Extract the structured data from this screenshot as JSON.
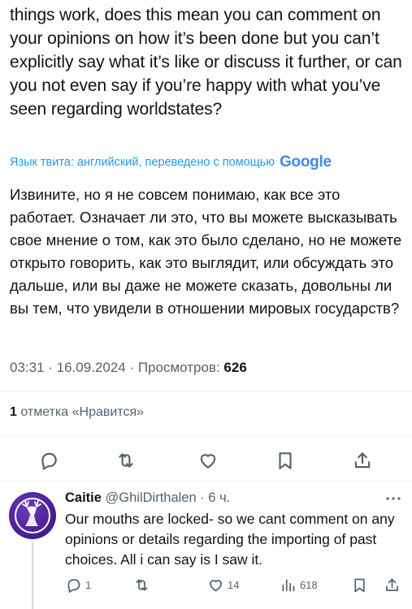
{
  "tweet": {
    "text_original": "things work, does this mean you can comment on your opinions on how it’s been done but you can’t explicitly say what it’s like or discuss it further, or can you not even say if you’re happy with what you’ve seen regarding worldstates?",
    "translation_note": "Язык твита: английский, переведено с помощью",
    "translation_provider": "Google",
    "text_translated": "Извините, но я не совсем понимаю, как все это работает. Означает ли это, что вы можете высказывать свое мнение о том, как это было сделано, но не можете открыто говорить, как это выглядит, или обсуждать это дальше, или вы даже не можете сказать, довольны ли вы тем, что увидели в отношении мировых государств?",
    "timestamp": "03:31 · 16.09.2024 · Просмотров:",
    "views": "626",
    "likes_count": "1",
    "likes_label": "отметка «Нравится»"
  },
  "actions": {
    "icons": [
      "reply-icon",
      "retweet-icon",
      "like-icon",
      "bookmark-icon",
      "share-icon"
    ],
    "color": "#536471"
  },
  "reply": {
    "author": "Caitie",
    "handle": "@GhilDirthalen",
    "time": "· 6 ч.",
    "text": "Our mouths are locked- so we cant comment on any opinions or details regarding the importing of past choices. All i can say is I saw it.",
    "reply_count": "1",
    "retweet_count": "",
    "like_count": "14",
    "views_count": "618"
  },
  "colors": {
    "text": "#0f1419",
    "secondary": "#536471",
    "link": "#1d9bf0",
    "avatar": "#4b1f95"
  }
}
